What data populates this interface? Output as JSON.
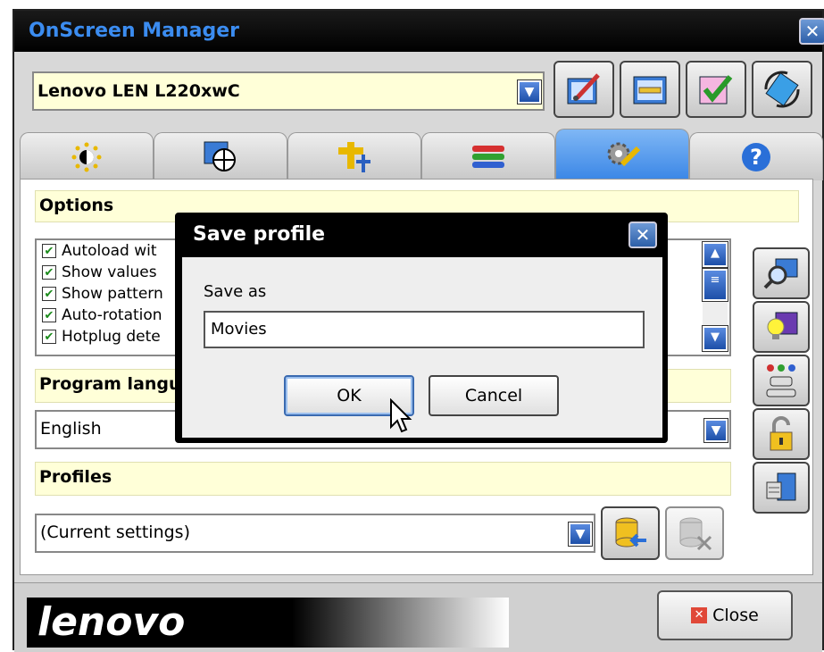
{
  "window": {
    "title": "OnScreen Manager",
    "close_icon": "close-icon"
  },
  "monitor": {
    "selected": "Lenovo LEN L220xwC"
  },
  "toolbar": {
    "icons": [
      "paint-icon",
      "ruler-icon",
      "check-icon",
      "rotate-icon"
    ]
  },
  "tabs": [
    {
      "icon": "brightness-icon",
      "active": false
    },
    {
      "icon": "geometry-icon",
      "active": false
    },
    {
      "icon": "position-icon",
      "active": false
    },
    {
      "icon": "color-icon",
      "active": false
    },
    {
      "icon": "settings-tools-icon",
      "active": true
    },
    {
      "icon": "help-icon",
      "active": false
    }
  ],
  "options": {
    "header": "Options",
    "items": [
      {
        "label": "Autoload wit",
        "checked": true
      },
      {
        "label": "Show values",
        "checked": true
      },
      {
        "label": "Show pattern",
        "checked": true
      },
      {
        "label": "Auto-rotation",
        "checked": true
      },
      {
        "label": "Hotplug dete",
        "checked": true
      }
    ]
  },
  "language": {
    "header": "Program langu",
    "selected": "English"
  },
  "profiles": {
    "header": "Profiles",
    "selected": "(Current settings)"
  },
  "sidebar": {
    "icons": [
      "search-display-icon",
      "lightbulb-monitor-icon",
      "connector-icon",
      "lock-icon",
      "display-info-icon"
    ]
  },
  "footer": {
    "logo": "lenovo",
    "close_label": "Close"
  },
  "dialog": {
    "title": "Save profile",
    "label": "Save as",
    "value": "Movies",
    "ok_label": "OK",
    "cancel_label": "Cancel"
  },
  "colors": {
    "accent": "#3a86e6",
    "title_text": "#3b8cf0",
    "header_bg": "#ffffd8"
  }
}
